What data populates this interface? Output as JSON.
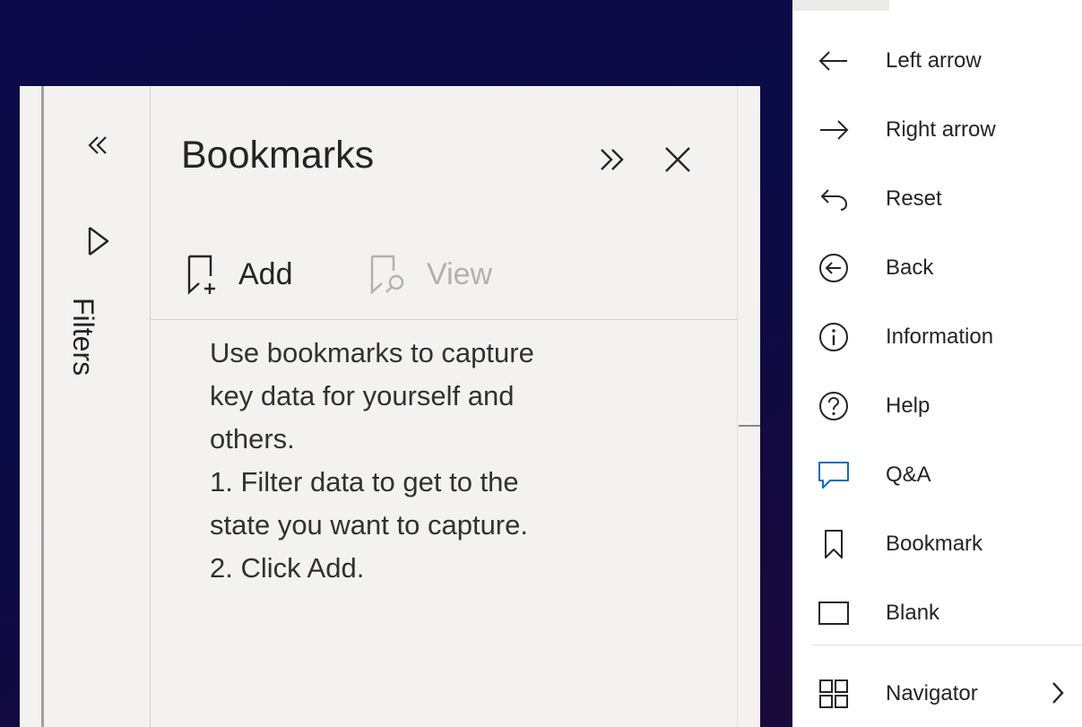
{
  "filters": {
    "label": "Filters"
  },
  "bookmarks": {
    "title": "Bookmarks",
    "toolbar": {
      "add_label": "Add",
      "view_label": "View"
    },
    "help_lines": [
      "Use bookmarks to capture",
      "key data for yourself and",
      "others.",
      "1. Filter data to get to the",
      "state you want to capture.",
      "2. Click Add."
    ]
  },
  "menu": {
    "items": [
      {
        "label": "Left arrow",
        "icon": "left-arrow-icon"
      },
      {
        "label": "Right arrow",
        "icon": "right-arrow-icon"
      },
      {
        "label": "Reset",
        "icon": "reset-icon"
      },
      {
        "label": "Back",
        "icon": "back-circle-icon"
      },
      {
        "label": "Information",
        "icon": "information-icon"
      },
      {
        "label": "Help",
        "icon": "help-icon"
      },
      {
        "label": "Q&A",
        "icon": "qa-icon"
      },
      {
        "label": "Bookmark",
        "icon": "bookmark-icon"
      },
      {
        "label": "Blank",
        "icon": "blank-icon"
      },
      {
        "label": "Navigator",
        "icon": "navigator-icon"
      }
    ]
  },
  "colors": {
    "background": "#0c0a48",
    "pane": "#f3f2f1",
    "text": "#252423",
    "disabled": "#b3b0ad",
    "qa_accent": "#0f6cbd"
  }
}
